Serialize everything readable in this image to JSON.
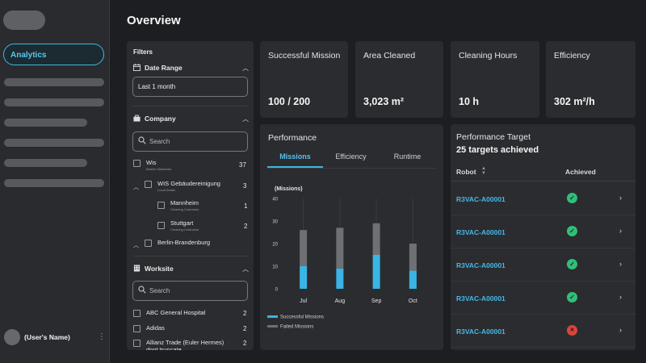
{
  "sidebar": {
    "active_item": "Analytics",
    "user_name": "(User's Name)",
    "menu_icon": "kebab-icon"
  },
  "page_title": "Overview",
  "filters": {
    "title": "Filters",
    "date_range": {
      "label": "Date Range",
      "value": "Last 1 month"
    },
    "company": {
      "label": "Company",
      "search_placeholder": "Search",
      "items": [
        {
          "name": "Wis",
          "sub": "Master Distributor",
          "count": "37"
        },
        {
          "name": "WIS Gebäudereinigung",
          "sub": "Local Dealer",
          "count": "3"
        },
        {
          "name": "Mannheim",
          "sub": "Cleaning Contractor",
          "count": "1"
        },
        {
          "name": "Stuttgart",
          "sub": "Cleaning Contractor",
          "count": "2"
        },
        {
          "name": "Berlin-Brandenburg",
          "sub": "",
          "count": ""
        }
      ]
    },
    "worksite": {
      "label": "Worksite",
      "search_placeholder": "Search",
      "items": [
        {
          "name": "ABC General Hospital",
          "count": "2"
        },
        {
          "name": "Adidas",
          "count": "2"
        },
        {
          "name": "Allianz Trade (Euler Hermes) dont truncate",
          "count": "2"
        }
      ]
    }
  },
  "kpis": [
    {
      "label": "Successful Mission",
      "value": "100 / 200"
    },
    {
      "label": "Area Cleaned",
      "value": "3,023 m²"
    },
    {
      "label": "Cleaning Hours",
      "value": "10 h"
    },
    {
      "label": "Efficiency",
      "value": "302 m²/h"
    }
  ],
  "performance": {
    "title": "Performance",
    "tabs": [
      "Missions",
      "Efficiency",
      "Runtime"
    ],
    "active_tab": "Missions"
  },
  "chart_data": {
    "type": "bar",
    "ylabel": "(Missions)",
    "ylim": [
      0,
      40
    ],
    "yticks": [
      0,
      10,
      20,
      30,
      40
    ],
    "categories": [
      "Jul",
      "Aug",
      "Sep",
      "Oct"
    ],
    "series": [
      {
        "name": "Successful Missions",
        "values": [
          10,
          9,
          15,
          8
        ],
        "color": "#3ab4e4"
      },
      {
        "name": "Failed Missions",
        "values": [
          16,
          18,
          14,
          12
        ],
        "color": "#6f7074"
      }
    ],
    "stacked": true,
    "legend_position": "bottom-left",
    "grid": "vertical"
  },
  "target": {
    "title": "Performance Target",
    "subtitle": "25 targets achieved",
    "col_robot": "Robot",
    "col_achieved": "Achieved",
    "rows": [
      {
        "id": "R3VAC-A00001",
        "status": "ok"
      },
      {
        "id": "R3VAC-A00001",
        "status": "ok"
      },
      {
        "id": "R3VAC-A00001",
        "status": "ok"
      },
      {
        "id": "R3VAC-A00001",
        "status": "ok"
      },
      {
        "id": "R3VAC-A00001",
        "status": "fail"
      }
    ]
  }
}
